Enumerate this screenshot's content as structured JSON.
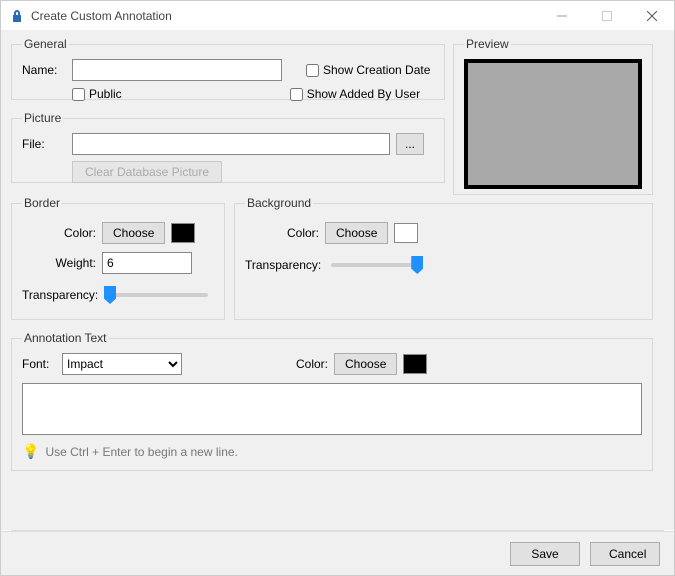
{
  "window": {
    "title": "Create Custom Annotation"
  },
  "general": {
    "legend": "General",
    "name_label": "Name:",
    "name_value": "",
    "public_label": "Public",
    "public_checked": false,
    "show_creation_label": "Show Creation Date",
    "show_creation_checked": false,
    "show_added_by_label": "Show Added By User",
    "show_added_by_checked": false
  },
  "preview": {
    "legend": "Preview"
  },
  "picture": {
    "legend": "Picture",
    "file_label": "File:",
    "file_value": "",
    "browse_label": "...",
    "clear_label": "Clear Database Picture"
  },
  "border": {
    "legend": "Border",
    "color_label": "Color:",
    "choose_label": "Choose",
    "color_value": "#000000",
    "weight_label": "Weight:",
    "weight_value": "6",
    "transparency_label": "Transparency:",
    "transparency_value": 0
  },
  "background": {
    "legend": "Background",
    "color_label": "Color:",
    "choose_label": "Choose",
    "color_value": "#ffffff",
    "transparency_label": "Transparency:",
    "transparency_value": 100
  },
  "annotation_text": {
    "legend": "Annotation Text",
    "font_label": "Font:",
    "font_value": "Impact",
    "color_label": "Color:",
    "choose_label": "Choose",
    "color_value": "#000000",
    "text_value": "",
    "hint": "Use Ctrl + Enter to begin a new line."
  },
  "footer": {
    "save": "Save",
    "cancel": "Cancel"
  }
}
